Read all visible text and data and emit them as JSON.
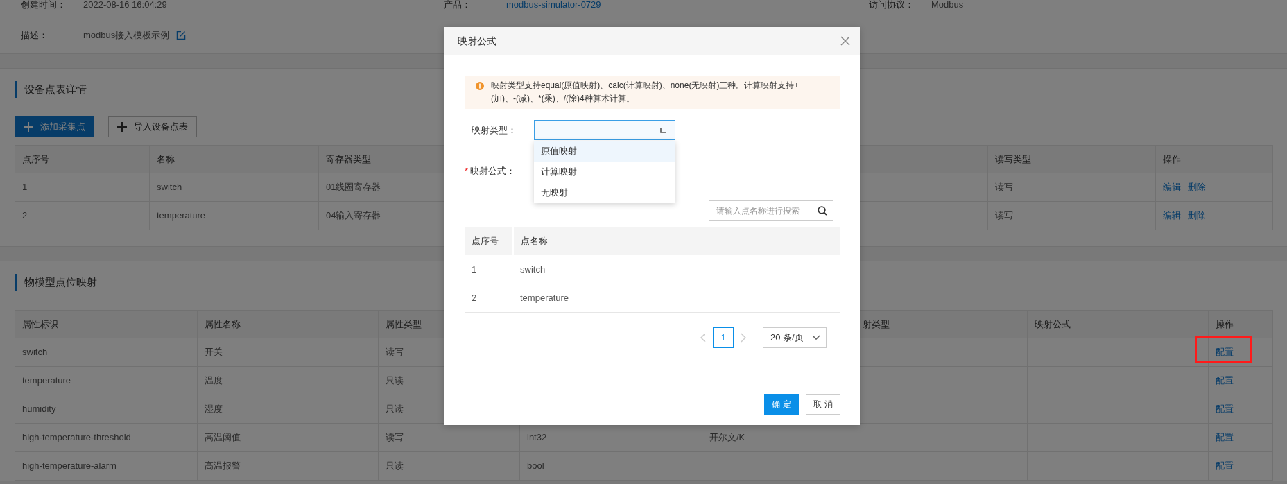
{
  "page": {
    "info": [
      {
        "label": "创建时间：",
        "value": "2022-08-16 16:04:29",
        "kind": "text"
      },
      {
        "label": "产品：",
        "value": "modbus-simulator-0729",
        "kind": "link"
      },
      {
        "label": "访问协议：",
        "value": "Modbus",
        "kind": "text"
      }
    ],
    "description": {
      "label": "描述：",
      "value": "modbus接入模板示例"
    }
  },
  "points": {
    "title": "设备点表详情",
    "buttons": [
      {
        "label": "添加采集点",
        "kind": "primary"
      },
      {
        "label": "导入设备点表",
        "kind": "default"
      }
    ],
    "columns": [
      "点序号",
      "名称",
      "寄存器类型",
      "读写类型",
      "操作"
    ],
    "rows": [
      {
        "index": "1",
        "name": "switch",
        "register": "01线圈寄存器",
        "access": "读写",
        "actions": [
          "编辑",
          "删除"
        ]
      },
      {
        "index": "2",
        "name": "temperature",
        "register": "04输入寄存器",
        "access": "读写",
        "actions": [
          "编辑",
          "删除"
        ]
      }
    ]
  },
  "mapping": {
    "title": "物模型点位映射",
    "columns": [
      {
        "label": "属性标识"
      },
      {
        "label": "属性名称"
      },
      {
        "label": "属性类型"
      },
      {},
      {},
      {
        "label": "射类型"
      },
      {
        "label": "映射公式"
      },
      {
        "label": "操作"
      }
    ],
    "rows": [
      {
        "id": "switch",
        "name": "开关",
        "access": "读写",
        "action": "配置",
        "annotated": true
      },
      {
        "id": "temperature",
        "name": "温度",
        "access": "只读",
        "action": "配置",
        "annotated": false
      },
      {
        "id": "humidity",
        "name": "湿度",
        "access": "只读",
        "action": "配置",
        "annotated": false
      },
      {
        "id": "high-temperature-threshold",
        "name": "高温阈值",
        "access": "读写",
        "data_type": "int32",
        "unit": "开尔文/K",
        "action": "配置",
        "annotated": false
      },
      {
        "id": "high-temperature-alarm",
        "name": "高温报警",
        "access": "只读",
        "data_type": "bool",
        "action": "配置",
        "annotated": false
      }
    ]
  },
  "modal": {
    "title": "映射公式",
    "notice": "映射类型支持equal(原值映射)、calc(计算映射)、none(无映射)三种。计算映射支持+(加)、-(减)、*(乘)、/(除)4种算术计算。",
    "type_field": {
      "label": "映射类型：",
      "expanded": true,
      "options": [
        {
          "label": "原值映射",
          "highlighted": true
        },
        {
          "label": "计算映射",
          "highlighted": false
        },
        {
          "label": "无映射",
          "highlighted": false
        }
      ]
    },
    "formula_field": {
      "label": "映射公式：",
      "required": true,
      "required_mark": "*"
    },
    "search": {
      "placeholder": "请输入点名称进行搜索"
    },
    "table": {
      "columns": [
        "点序号",
        "点名称"
      ],
      "rows": [
        {
          "index": "1",
          "name": "switch"
        },
        {
          "index": "2",
          "name": "temperature"
        }
      ]
    },
    "pagination": {
      "pages": [
        {
          "label": "1",
          "selected": true
        }
      ],
      "page_size": "20 条/页"
    },
    "buttons": [
      {
        "label": "确 定",
        "kind": "primary"
      },
      {
        "label": "取 消",
        "kind": "default"
      }
    ]
  }
}
